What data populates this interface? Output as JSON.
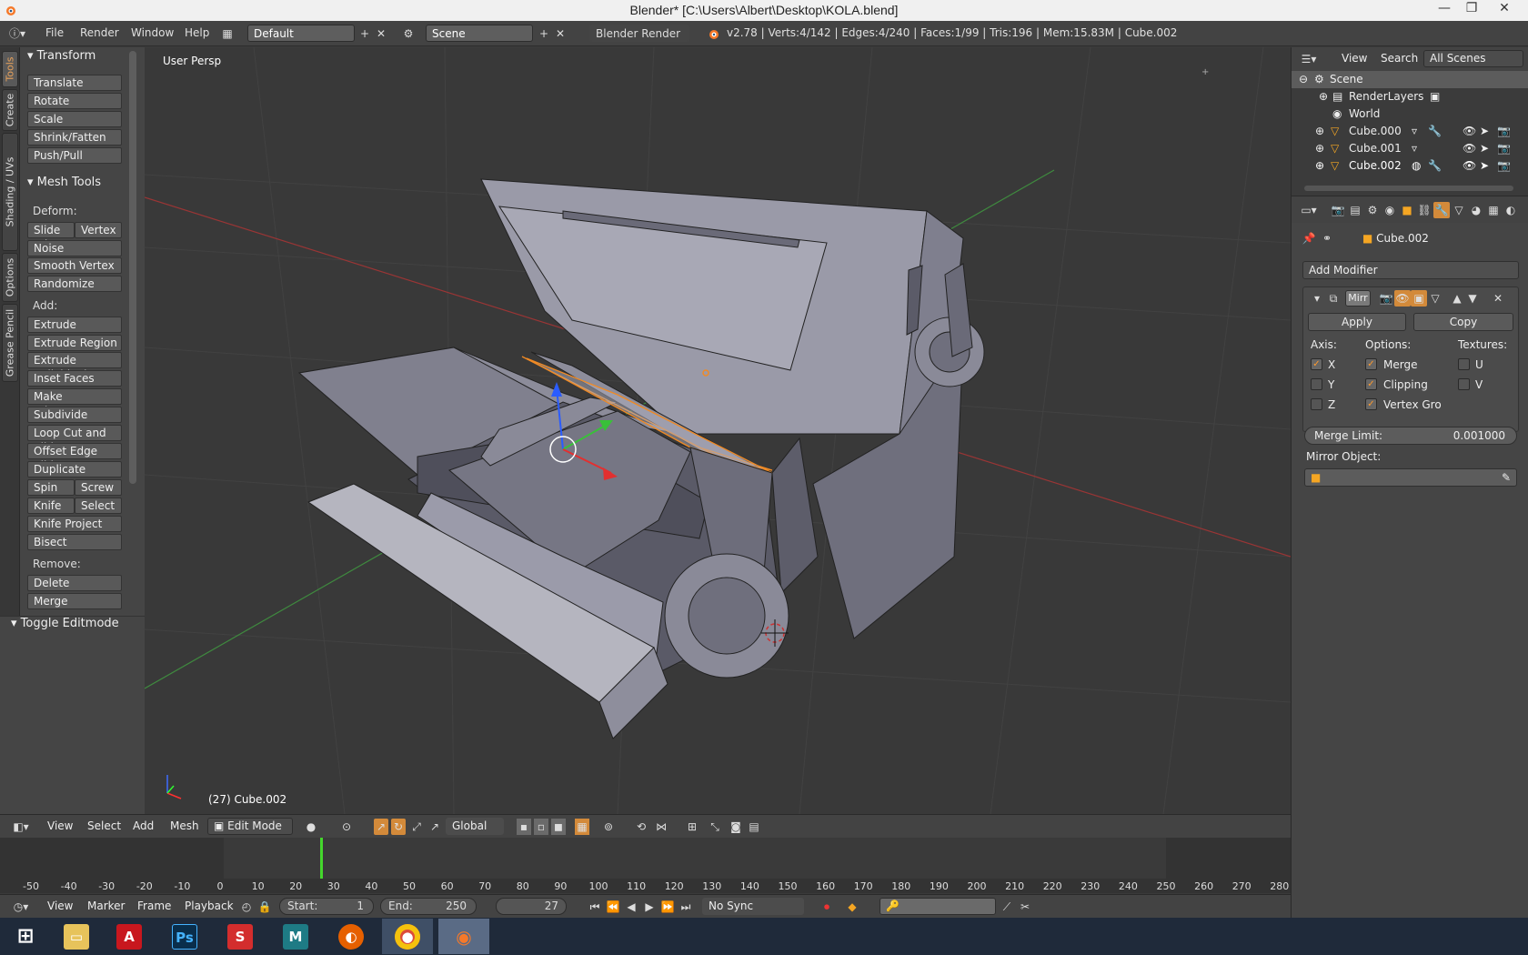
{
  "window": {
    "title": "Blender* [C:\\Users\\Albert\\Desktop\\KOLA.blend]",
    "minimize": "—",
    "maximize": "❐",
    "close": "✕"
  },
  "info_header": {
    "menus": [
      "File",
      "Render",
      "Window",
      "Help"
    ],
    "layout": "Default",
    "scene": "Scene",
    "engine": "Blender Render",
    "stats": "v2.78 | Verts:4/142 | Edges:4/240 | Faces:1/99 | Tris:196 | Mem:15.83M | Cube.002"
  },
  "tool_tabs": [
    "Tools",
    "Create",
    "Shading / UVs",
    "Options",
    "Grease Pencil"
  ],
  "transform_panel": {
    "title": "Transform",
    "buttons": [
      "Translate",
      "Rotate",
      "Scale",
      "Shrink/Fatten",
      "Push/Pull"
    ]
  },
  "mesh_tools_panel": {
    "title": "Mesh Tools",
    "deform_label": "Deform:",
    "slide_edge": "Slide Ed",
    "vertex": "Vertex",
    "noise": "Noise",
    "smooth_vertex": "Smooth Vertex",
    "randomize": "Randomize",
    "add_label": "Add:",
    "extrude": "Extrude",
    "extrude_region": "Extrude Region",
    "extrude_individual": "Extrude Individual",
    "inset_faces": "Inset Faces",
    "make_edge_face": "Make Edge/Face",
    "subdivide": "Subdivide",
    "loop_cut": "Loop Cut and Slide",
    "offset_edge": "Offset Edge Slide",
    "duplicate": "Duplicate",
    "spin": "Spin",
    "screw": "Screw",
    "knife": "Knife",
    "select": "Select",
    "knife_project": "Knife Project",
    "bisect": "Bisect",
    "remove_label": "Remove:",
    "delete": "Delete",
    "merge": "Merge"
  },
  "toggle_editmode": "Toggle Editmode",
  "viewport": {
    "label": "User Persp",
    "object_info": "(27) Cube.002"
  },
  "view3d_header": {
    "menus": [
      "View",
      "Select",
      "Add",
      "Mesh"
    ],
    "mode": "Edit Mode",
    "orientation": "Global"
  },
  "timeline": {
    "ticks": [
      "-50",
      "-40",
      "-30",
      "-20",
      "-10",
      "0",
      "10",
      "20",
      "30",
      "40",
      "50",
      "60",
      "70",
      "80",
      "90",
      "100",
      "110",
      "120",
      "130",
      "140",
      "150",
      "160",
      "170",
      "180",
      "190",
      "200",
      "210",
      "220",
      "230",
      "240",
      "250",
      "260",
      "270",
      "280"
    ],
    "menus": [
      "View",
      "Marker",
      "Frame",
      "Playback"
    ],
    "start_label": "Start:",
    "start_value": "1",
    "end_label": "End:",
    "end_value": "250",
    "current_frame": "27",
    "sync": "No Sync"
  },
  "outliner": {
    "menus": [
      "View",
      "Search"
    ],
    "filter": "All Scenes",
    "items": [
      "Scene",
      "RenderLayers",
      "World",
      "Cube.000",
      "Cube.001",
      "Cube.002"
    ]
  },
  "properties": {
    "object_name": "Cube.002",
    "add_modifier": "Add Modifier",
    "modifier_name": "Mirr",
    "apply": "Apply",
    "copy": "Copy",
    "axis_label": "Axis:",
    "options_label": "Options:",
    "textures_label": "Textures:",
    "axis_x": "X",
    "axis_y": "Y",
    "axis_z": "Z",
    "opt_merge": "Merge",
    "opt_clipping": "Clipping",
    "opt_vertex_groups": "Vertex Gro",
    "tex_u": "U",
    "tex_v": "V",
    "merge_limit_label": "Merge Limit:",
    "merge_limit_value": "0.001000",
    "mirror_object_label": "Mirror Object:"
  },
  "taskbar": {
    "apps": [
      "windows-start",
      "file-explorer",
      "acrobat",
      "photoshop",
      "sketchup",
      "maya",
      "firefox",
      "chrome",
      "blender"
    ],
    "photoshop_label": "Ps"
  },
  "colors": {
    "accent": "#e8a25b",
    "selection_orange": "#f08a24",
    "frame_marker": "#44d62c"
  }
}
